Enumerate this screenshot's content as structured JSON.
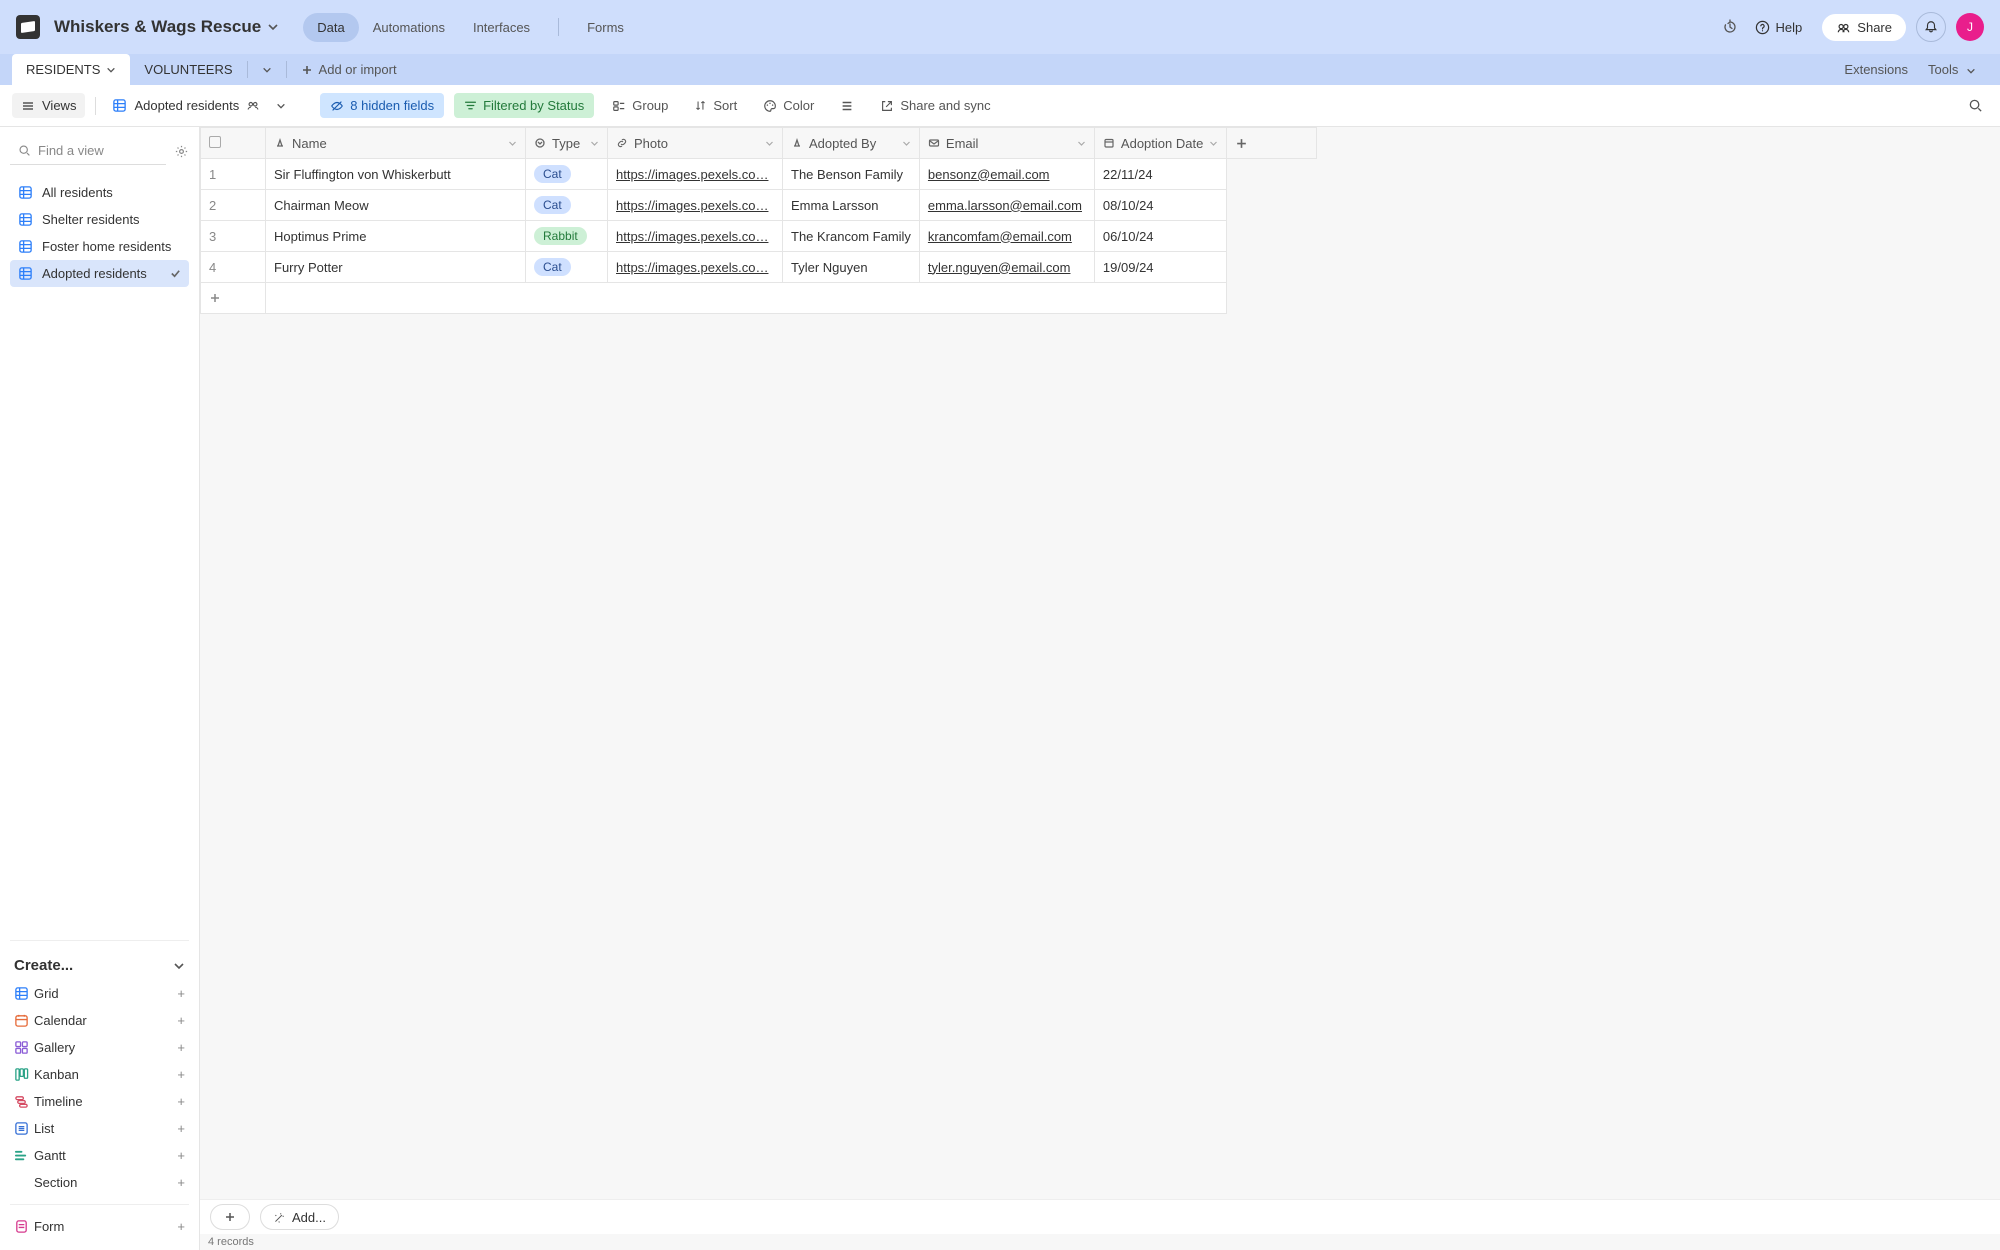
{
  "header": {
    "workspace_name": "Whiskers & Wags Rescue",
    "nav": {
      "data": "Data",
      "automations": "Automations",
      "interfaces": "Interfaces",
      "forms": "Forms"
    },
    "help": "Help",
    "share": "Share",
    "avatar_initial": "J"
  },
  "tabs": {
    "residents": "RESIDENTS",
    "volunteers": "VOLUNTEERS",
    "add_import": "Add or import",
    "extensions": "Extensions",
    "tools": "Tools"
  },
  "toolbar": {
    "views": "Views",
    "view_name": "Adopted residents",
    "hidden_fields": "8 hidden fields",
    "filter": "Filtered by Status",
    "group": "Group",
    "sort": "Sort",
    "color": "Color",
    "share_sync": "Share and sync"
  },
  "sidebar": {
    "find_placeholder": "Find a view",
    "views": [
      {
        "label": "All residents"
      },
      {
        "label": "Shelter residents"
      },
      {
        "label": "Foster home residents"
      },
      {
        "label": "Adopted residents"
      }
    ],
    "create_header": "Create...",
    "create_items": {
      "grid": "Grid",
      "calendar": "Calendar",
      "gallery": "Gallery",
      "kanban": "Kanban",
      "timeline": "Timeline",
      "list": "List",
      "gantt": "Gantt",
      "section": "Section",
      "form": "Form"
    }
  },
  "grid": {
    "columns": {
      "name": "Name",
      "type": "Type",
      "photo": "Photo",
      "adopted_by": "Adopted By",
      "email": "Email",
      "adoption_date": "Adoption Date"
    },
    "rows": [
      {
        "n": "1",
        "name": "Sir Fluffington von Whiskerbutt",
        "type": "Cat",
        "type_class": "pill-cat",
        "photo": "https://images.pexels.co…",
        "adopted_by": "The Benson Family",
        "email": "bensonz@email.com",
        "date": "22/11/24"
      },
      {
        "n": "2",
        "name": "Chairman Meow",
        "type": "Cat",
        "type_class": "pill-cat",
        "photo": "https://images.pexels.co…",
        "adopted_by": "Emma Larsson",
        "email": "emma.larsson@email.com",
        "date": "08/10/24"
      },
      {
        "n": "3",
        "name": "Hoptimus Prime",
        "type": "Rabbit",
        "type_class": "pill-rabbit",
        "photo": "https://images.pexels.co…",
        "adopted_by": "The Krancom Family",
        "email": "krancomfam@email.com",
        "date": "06/10/24"
      },
      {
        "n": "4",
        "name": "Furry Potter",
        "type": "Cat",
        "type_class": "pill-cat",
        "photo": "https://images.pexels.co…",
        "adopted_by": "Tyler Nguyen",
        "email": "tyler.nguyen@email.com",
        "date": "19/09/24"
      }
    ],
    "footer_add": "Add...",
    "record_count": "4 records"
  }
}
